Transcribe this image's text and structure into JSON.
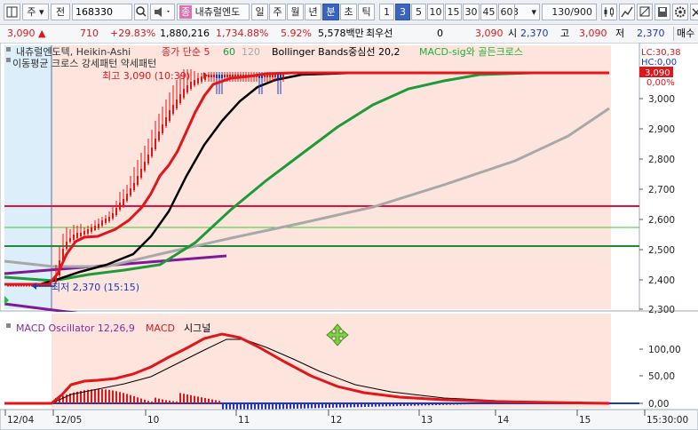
{
  "toolbar": {
    "market_label": "주",
    "period_label": "전",
    "code": "168330",
    "stock_name": "내츄럴엔도",
    "badge": "종",
    "periods": [
      "일",
      "주",
      "월",
      "년",
      "분",
      "초",
      "틱"
    ],
    "selected_period": "분",
    "intervals": [
      "1",
      "3",
      "5",
      "10",
      "15",
      "30",
      "45",
      "60"
    ],
    "selected_interval": "3",
    "interval_select": "3",
    "count": "130/900"
  },
  "quote": {
    "price": "3,090",
    "change": "710",
    "change_pct": "+29.83%",
    "volume": "1,880,216",
    "amount": "1,734.88%",
    "ratio": "5.92%",
    "value": "5,578백만",
    "bid_label": "최우선",
    "bid": "0",
    "ask": "3,090",
    "open_label": "시",
    "open": "2,370",
    "high_label": "고",
    "high": "3,090",
    "low_label": "저",
    "low": "2,370",
    "trade_label": "매수"
  },
  "price_panel": {
    "legend_name": "내츄럴엔도텍, Heikin-Ashi",
    "legend_ma": "종가 단순 5",
    "legend_ma2": "60",
    "legend_ma3": "120",
    "legend_bb": "Bollinger Bands중심선 20,2",
    "legend_macd": "MACD-sig와 골든크로스",
    "legend_pattern": "이동평균 크로스 강세패턴  약세패턴",
    "high_annot": "최고 3,090 (10:39)",
    "low_annot": "최저 2,370 (15:15)",
    "axis_labels": [
      "3,000",
      "2,900",
      "2,800",
      "2,700",
      "2,600",
      "2,500",
      "2,400",
      "2,300"
    ],
    "lc_label": "LC:30,38",
    "hc_label": "HC:0,00",
    "current_price_tag": "3,090",
    "pct_label": "0,00%"
  },
  "macd_panel": {
    "legend_osc": "MACD Oscillator 12,26,9",
    "legend_macd": "MACD",
    "legend_signal": "시그널",
    "axis_labels": [
      "100,00",
      "50,00",
      "0,00"
    ]
  },
  "time_axis": {
    "labels": [
      "12/04",
      "12/05",
      "10",
      "11",
      "12",
      "13",
      "14",
      "15",
      "15:30:00"
    ]
  },
  "colors": {
    "up": "#e0161b",
    "down": "#1c38c0",
    "ma5": "#e0161b",
    "ma60": "#1f9a3b",
    "ma120": "#a8a8a8",
    "bb": "#000000",
    "session_bg": "#fde4dc"
  },
  "icons": [
    "layout-icon",
    "speaker-icon",
    "dropdown-icon",
    "candle-icon",
    "cross-icon",
    "drawing-icon",
    "save-icon",
    "settings-icon",
    "close-icon",
    "move-icon"
  ]
}
